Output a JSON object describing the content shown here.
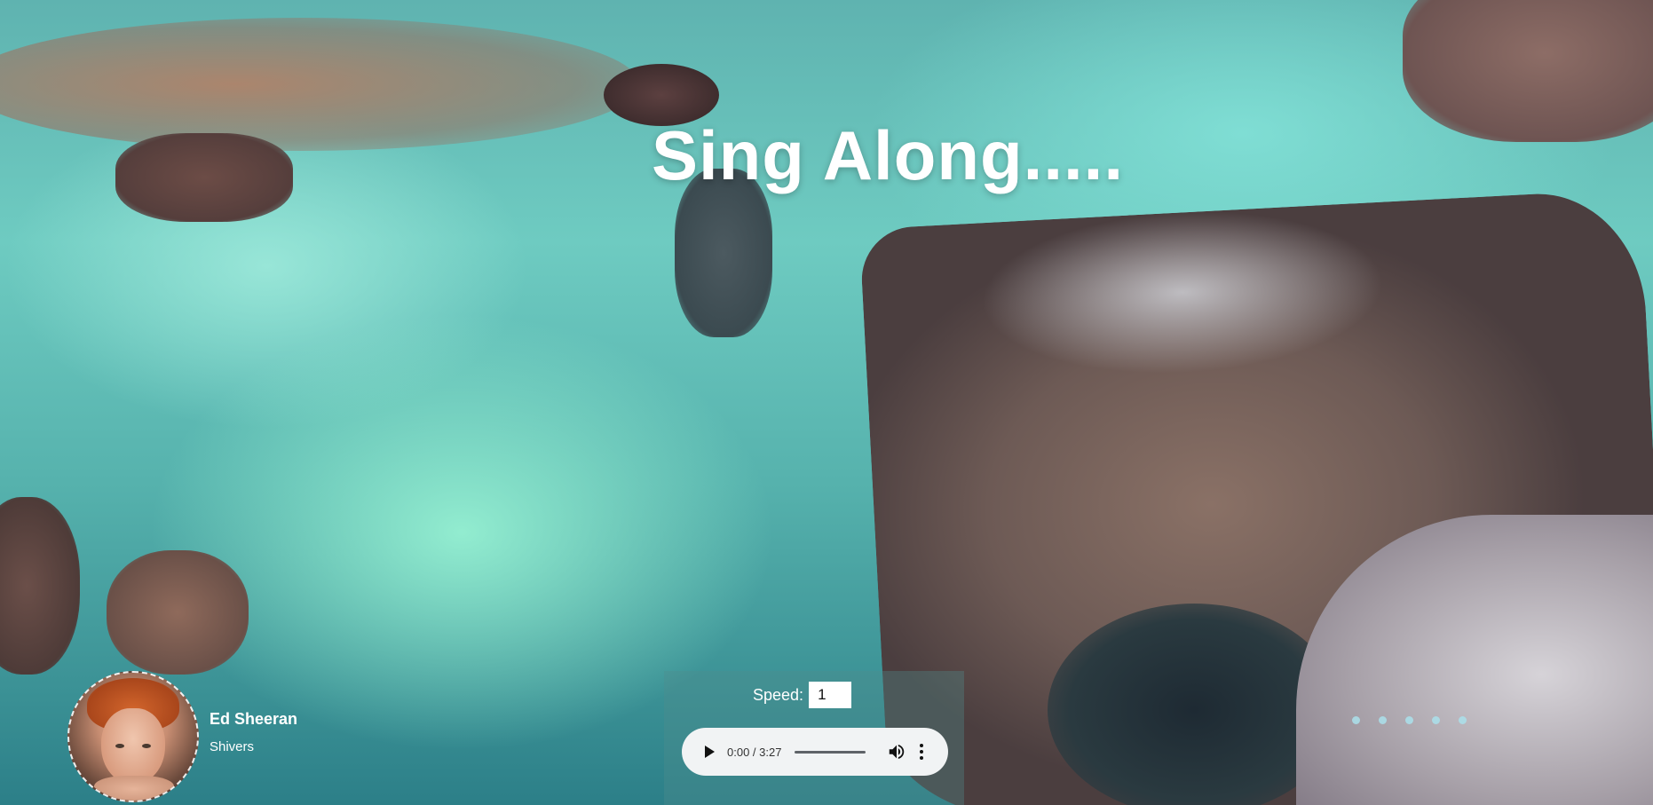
{
  "header": {
    "title": "Sing Along....."
  },
  "artist": {
    "name": "Ed Sheeran",
    "song": "Shivers"
  },
  "player": {
    "speed_label": "Speed:",
    "speed_value": "1",
    "time_display": "0:00 / 3:27",
    "progress": 0
  },
  "carousel": {
    "dots": 5
  },
  "icons": {
    "play": "play-icon",
    "volume": "volume-icon",
    "menu": "more-vert-icon"
  }
}
